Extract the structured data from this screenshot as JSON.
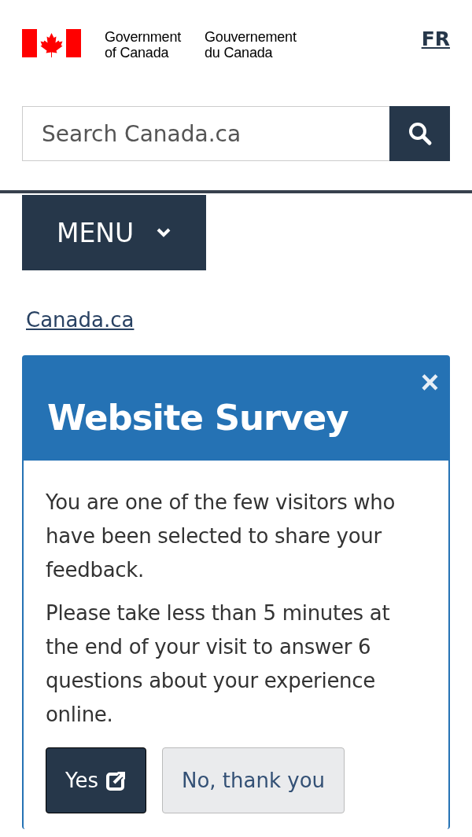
{
  "header": {
    "signature_en": [
      "Government",
      "of Canada"
    ],
    "signature_fr": [
      "Gouvernement",
      "du Canada"
    ],
    "language_link": "FR"
  },
  "search": {
    "placeholder": "Search Canada.ca"
  },
  "menu": {
    "label": "MENU",
    "expanded": false
  },
  "breadcrumb": "Canada.ca",
  "dialog": {
    "close": "×",
    "title": "Website Survey",
    "paragraphs": [
      "You are one of the few visitors who have been selected to share your feedback.",
      "Please take less than 5 minutes at the end of your visit to answer 6 questions about your experience online."
    ],
    "buttons": [
      {
        "label": "Yes",
        "kind": "primary"
      },
      {
        "label": "No, thank you",
        "kind": "secondary"
      }
    ]
  }
}
